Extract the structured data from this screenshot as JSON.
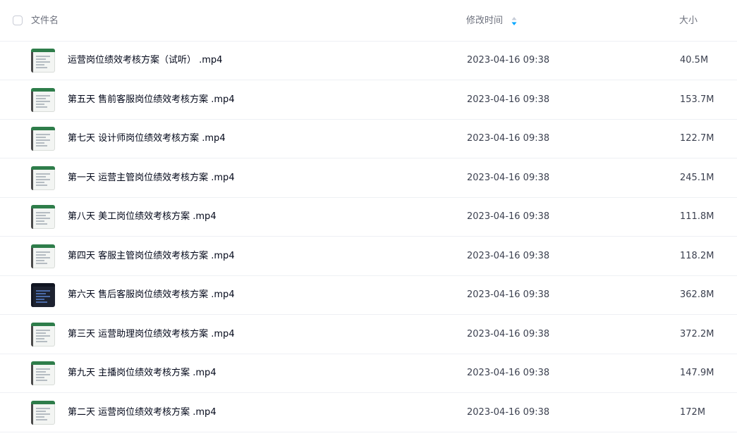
{
  "header": {
    "name_label": "文件名",
    "mtime_label": "修改时间",
    "size_label": "大小",
    "sort_icon": "sort-icon",
    "accent_color": "#06a7ff"
  },
  "files": [
    {
      "name": "运营岗位绩效考核方案（试听） .mp4",
      "mtime": "2023-04-16 09:38",
      "size": "40.5M",
      "thumb": "video-thumbnail-spreadsheet"
    },
    {
      "name": "第五天 售前客服岗位绩效考核方案 .mp4",
      "mtime": "2023-04-16 09:38",
      "size": "153.7M",
      "thumb": "video-thumbnail-spreadsheet"
    },
    {
      "name": "第七天 设计师岗位绩效考核方案 .mp4",
      "mtime": "2023-04-16 09:38",
      "size": "122.7M",
      "thumb": "video-thumbnail-spreadsheet"
    },
    {
      "name": "第一天 运营主管岗位绩效考核方案 .mp4",
      "mtime": "2023-04-16 09:38",
      "size": "245.1M",
      "thumb": "video-thumbnail-spreadsheet"
    },
    {
      "name": "第八天 美工岗位绩效考核方案 .mp4",
      "mtime": "2023-04-16 09:38",
      "size": "111.8M",
      "thumb": "video-thumbnail-spreadsheet"
    },
    {
      "name": "第四天 客服主管岗位绩效考核方案 .mp4",
      "mtime": "2023-04-16 09:38",
      "size": "118.2M",
      "thumb": "video-thumbnail-spreadsheet"
    },
    {
      "name": "第六天 售后客服岗位绩效考核方案 .mp4",
      "mtime": "2023-04-16 09:38",
      "size": "362.8M",
      "thumb": "video-thumbnail-dark"
    },
    {
      "name": "第三天 运营助理岗位绩效考核方案 .mp4",
      "mtime": "2023-04-16 09:38",
      "size": "372.2M",
      "thumb": "video-thumbnail-spreadsheet"
    },
    {
      "name": "第九天 主播岗位绩效考核方案 .mp4",
      "mtime": "2023-04-16 09:38",
      "size": "147.9M",
      "thumb": "video-thumbnail-document"
    },
    {
      "name": "第二天 运营岗位绩效考核方案 .mp4",
      "mtime": "2023-04-16 09:38",
      "size": "172M",
      "thumb": "video-thumbnail-spreadsheet"
    }
  ]
}
